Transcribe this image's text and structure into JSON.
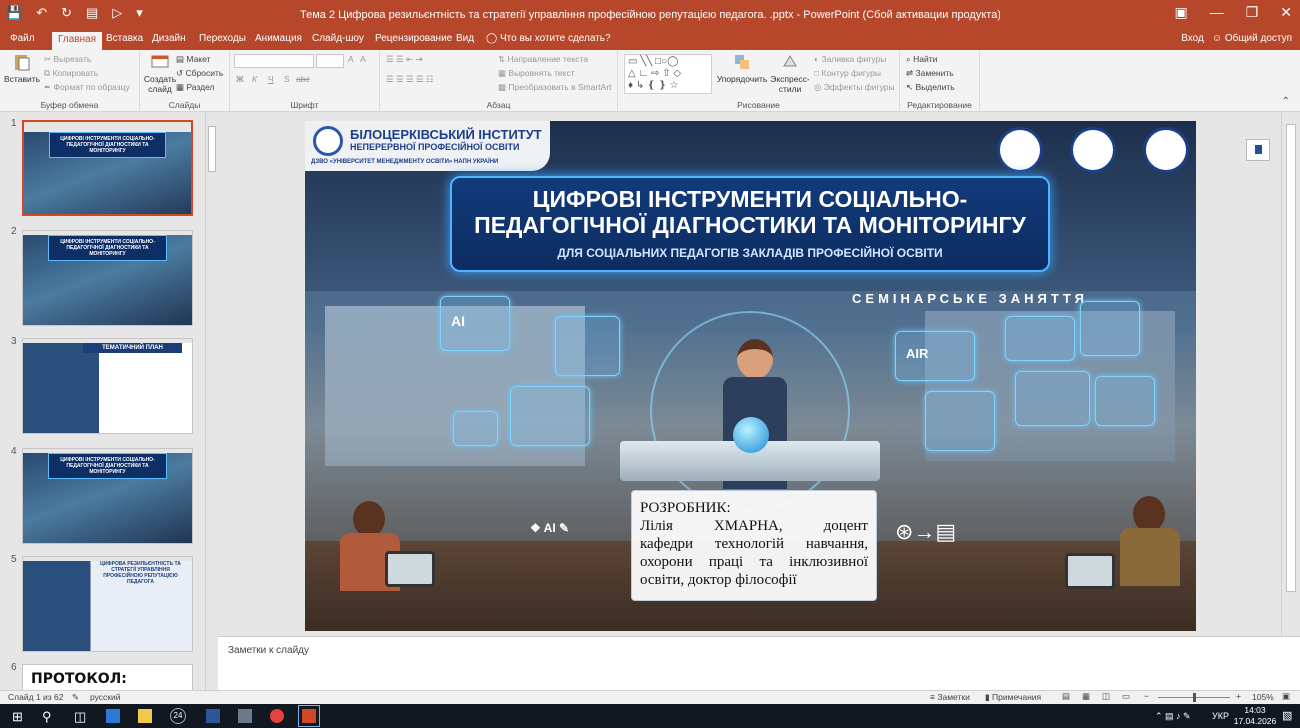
{
  "window": {
    "title": "Тема 2 Цифрова резильєнтність та стратегії управління професійною репутацією педагога. .pptx - PowerPoint (Сбой активации продукта)"
  },
  "tabs": [
    {
      "label": "Файл"
    },
    {
      "label": "Главная"
    },
    {
      "label": "Вставка"
    },
    {
      "label": "Дизайн"
    },
    {
      "label": "Переходы"
    },
    {
      "label": "Анимация"
    },
    {
      "label": "Слайд-шоу"
    },
    {
      "label": "Рецензирование"
    },
    {
      "label": "Вид"
    },
    {
      "label": "Что вы хотите сделать?"
    }
  ],
  "account": {
    "signin": "Вход",
    "share": "Общий доступ"
  },
  "ribbon": {
    "clipboard": {
      "paste": "Вставить",
      "cut": "Вырезать",
      "copy": "Копировать",
      "format": "Формат по образцу",
      "label": "Буфер обмена"
    },
    "slides": {
      "new": "Создать слайд",
      "layout": "Макет",
      "reset": "Сбросить",
      "section": "Раздел",
      "label": "Слайды"
    },
    "font": {
      "label": "Шрифт",
      "bold": "Ж",
      "italic": "К",
      "underline": "Ч",
      "strike": "S",
      "spacing": "abc",
      "size_up": "A",
      "size_down": "A"
    },
    "paragraph": {
      "direction": "Направление текста",
      "align": "Выровнять текст",
      "smartart": "Преобразовать в SmartArt",
      "label": "Абзац"
    },
    "drawing": {
      "arrange": "Упорядочить",
      "quick": "Экспресс-стили",
      "fill": "Заливка фигуры",
      "outline": "Контур фигуры",
      "effects": "Эффекты фигуры",
      "label": "Рисование"
    },
    "editing": {
      "find": "Найти",
      "replace": "Заменить",
      "select": "Выделить",
      "label": "Редактирование"
    }
  },
  "thumbnails": [
    {
      "num": "1",
      "title": "ЦИФРОВІ ІНСТРУМЕНТИ СОЦІАЛЬНО-ПЕДАГОГІЧНОЇ ДІАГНОСТИКИ ТА МОНІТОРИНГУ"
    },
    {
      "num": "2",
      "title": "ЦИФРОВІ ІНСТРУМЕНТИ СОЦІАЛЬНО-ПЕДАГОГІЧНОЇ ДІАГНОСТИКИ ТА МОНІТОРИНГУ"
    },
    {
      "num": "3",
      "title": "ТЕМАТИЧНИЙ ПЛАН"
    },
    {
      "num": "4",
      "title": "ЦИФРОВІ ІНСТРУМЕНТИ СОЦІАЛЬНО-ПЕДАГОГІЧНОЇ ДІАГНОСТИКИ ТА МОНІТОРИНГУ"
    },
    {
      "num": "5",
      "title": "ЦИФРОВА РЕЗИЛЬЄНТНІСТЬ ТА СТРАТЕГІЇ УПРАВЛІННЯ ПРОФЕСІЙНОЮ РЕПУТАЦІЄЮ ПЕДАГОГА"
    },
    {
      "num": "6",
      "title": "ПРОТОКОЛ:"
    }
  ],
  "slide": {
    "institute_line1": "БІЛОЦЕРКІВСЬКИЙ ІНСТИТУТ",
    "institute_line2": "НЕПЕРЕРВНОЇ ПРОФЕСІЙНОЇ ОСВІТИ",
    "institute_line3": "ДЗВО «УНІВЕРСИТЕТ МЕНЕДЖМЕНТУ ОСВІТИ» НАПН УКРАЇНИ",
    "title_line1": "ЦИФРОВІ ІНСТРУМЕНТИ СОЦІАЛЬНО-",
    "title_line2": "ПЕДАГОГІЧНОЇ ДІАГНОСТИКИ ТА МОНІТОРИНГУ",
    "subtitle": "ДЛЯ СОЦІАЛЬНИХ ПЕДАГОГІВ ЗАКЛАДІВ ПРОФЕСІЙНОЇ ОСВІТИ",
    "seminar": "СЕМІНАРСЬКЕ ЗАНЯТТЯ",
    "author_label": "РОЗРОБНИК:",
    "author_line1": "Лілія ХМАРНА, доцент",
    "author_line2": "кафедри технологій навчання,",
    "author_line3": "охорони праці та інклюзивної",
    "author_line4": "освіти, доктор філософії",
    "ai_label": "AI",
    "air_label": "AIR"
  },
  "notes": {
    "placeholder": "Заметки к слайду"
  },
  "status": {
    "slide_info": "Слайд 1 из 62",
    "language": "русский",
    "notes_btn": "Заметки",
    "comments_btn": "Примечания",
    "zoom": "105%"
  },
  "taskbar": {
    "badge": "24",
    "lang": "УКР",
    "time": "14:03",
    "date": "17.04.2026"
  },
  "colors": {
    "accent": "#b7472a",
    "selected_border": "#d24726"
  }
}
